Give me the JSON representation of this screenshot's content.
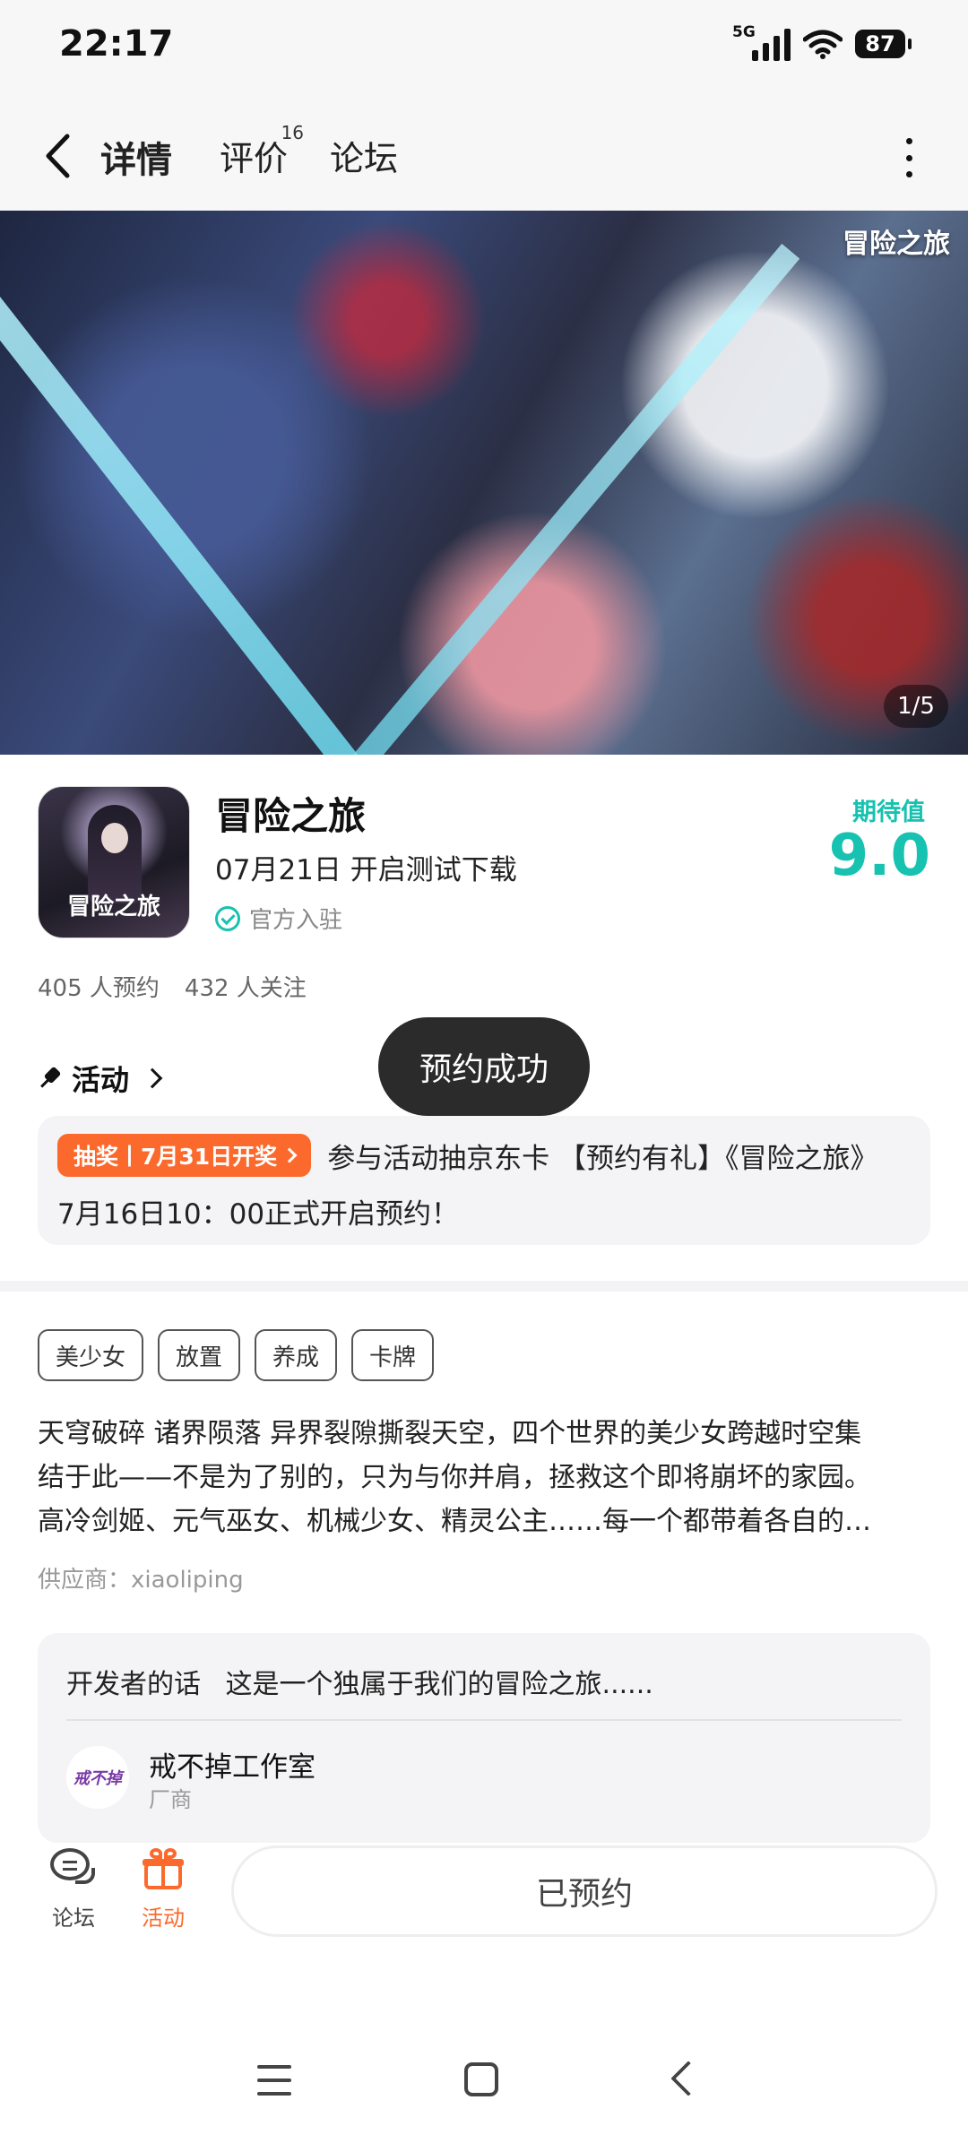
{
  "status_bar": {
    "time": "22:17",
    "network": "5G",
    "battery": "87",
    "icons": [
      "signal-icon",
      "wifi-icon",
      "battery-icon"
    ]
  },
  "nav": {
    "tabs": [
      {
        "label": "详情",
        "active": true
      },
      {
        "label": "评价",
        "badge": "16"
      },
      {
        "label": "论坛"
      }
    ],
    "accent_color": "#17c2b0"
  },
  "banner": {
    "logo_text": "冒险之旅",
    "page_indicator": "1/5"
  },
  "game": {
    "icon_text": "冒险之旅",
    "title": "冒险之旅",
    "release_info": "07月21日 开启测试下载",
    "official_label": "官方入驻",
    "score_label": "期待值",
    "score_value": "9.0",
    "reservations": "405 人预约",
    "followers": "432 人关注"
  },
  "toast": {
    "message": "预约成功"
  },
  "activity": {
    "header": "活动",
    "badge": "抽奖丨7月31日开奖",
    "text_line1": "参与活动抽京东卡 【预约有礼】《冒险之旅》",
    "text_line2": "7月16日10：00正式开启预约！",
    "badge_color": "#fb6a2c"
  },
  "tags": [
    "美少女",
    "放置",
    "养成",
    "卡牌"
  ],
  "description": {
    "lines": [
      "天穹破碎 诸界陨落 异界裂隙撕裂天空，四个世界的美少女跨越时空集",
      "结于此——不是为了别的，只为与你并肩，拯救这个即将崩坏的家园。",
      "高冷剑姬、元气巫女、机械少女、精灵公主……每一个都带着各自的…"
    ]
  },
  "supplier": "供应商：xiaoliping",
  "developer": {
    "label": "开发者的话",
    "message": "这是一个独属于我们的冒险之旅......",
    "avatar_text": "戒不掉",
    "name": "戒不掉工作室",
    "role": "厂商"
  },
  "bottom_bar": {
    "forum_label": "论坛",
    "activity_label": "活动",
    "reserve_button": "已预约"
  }
}
